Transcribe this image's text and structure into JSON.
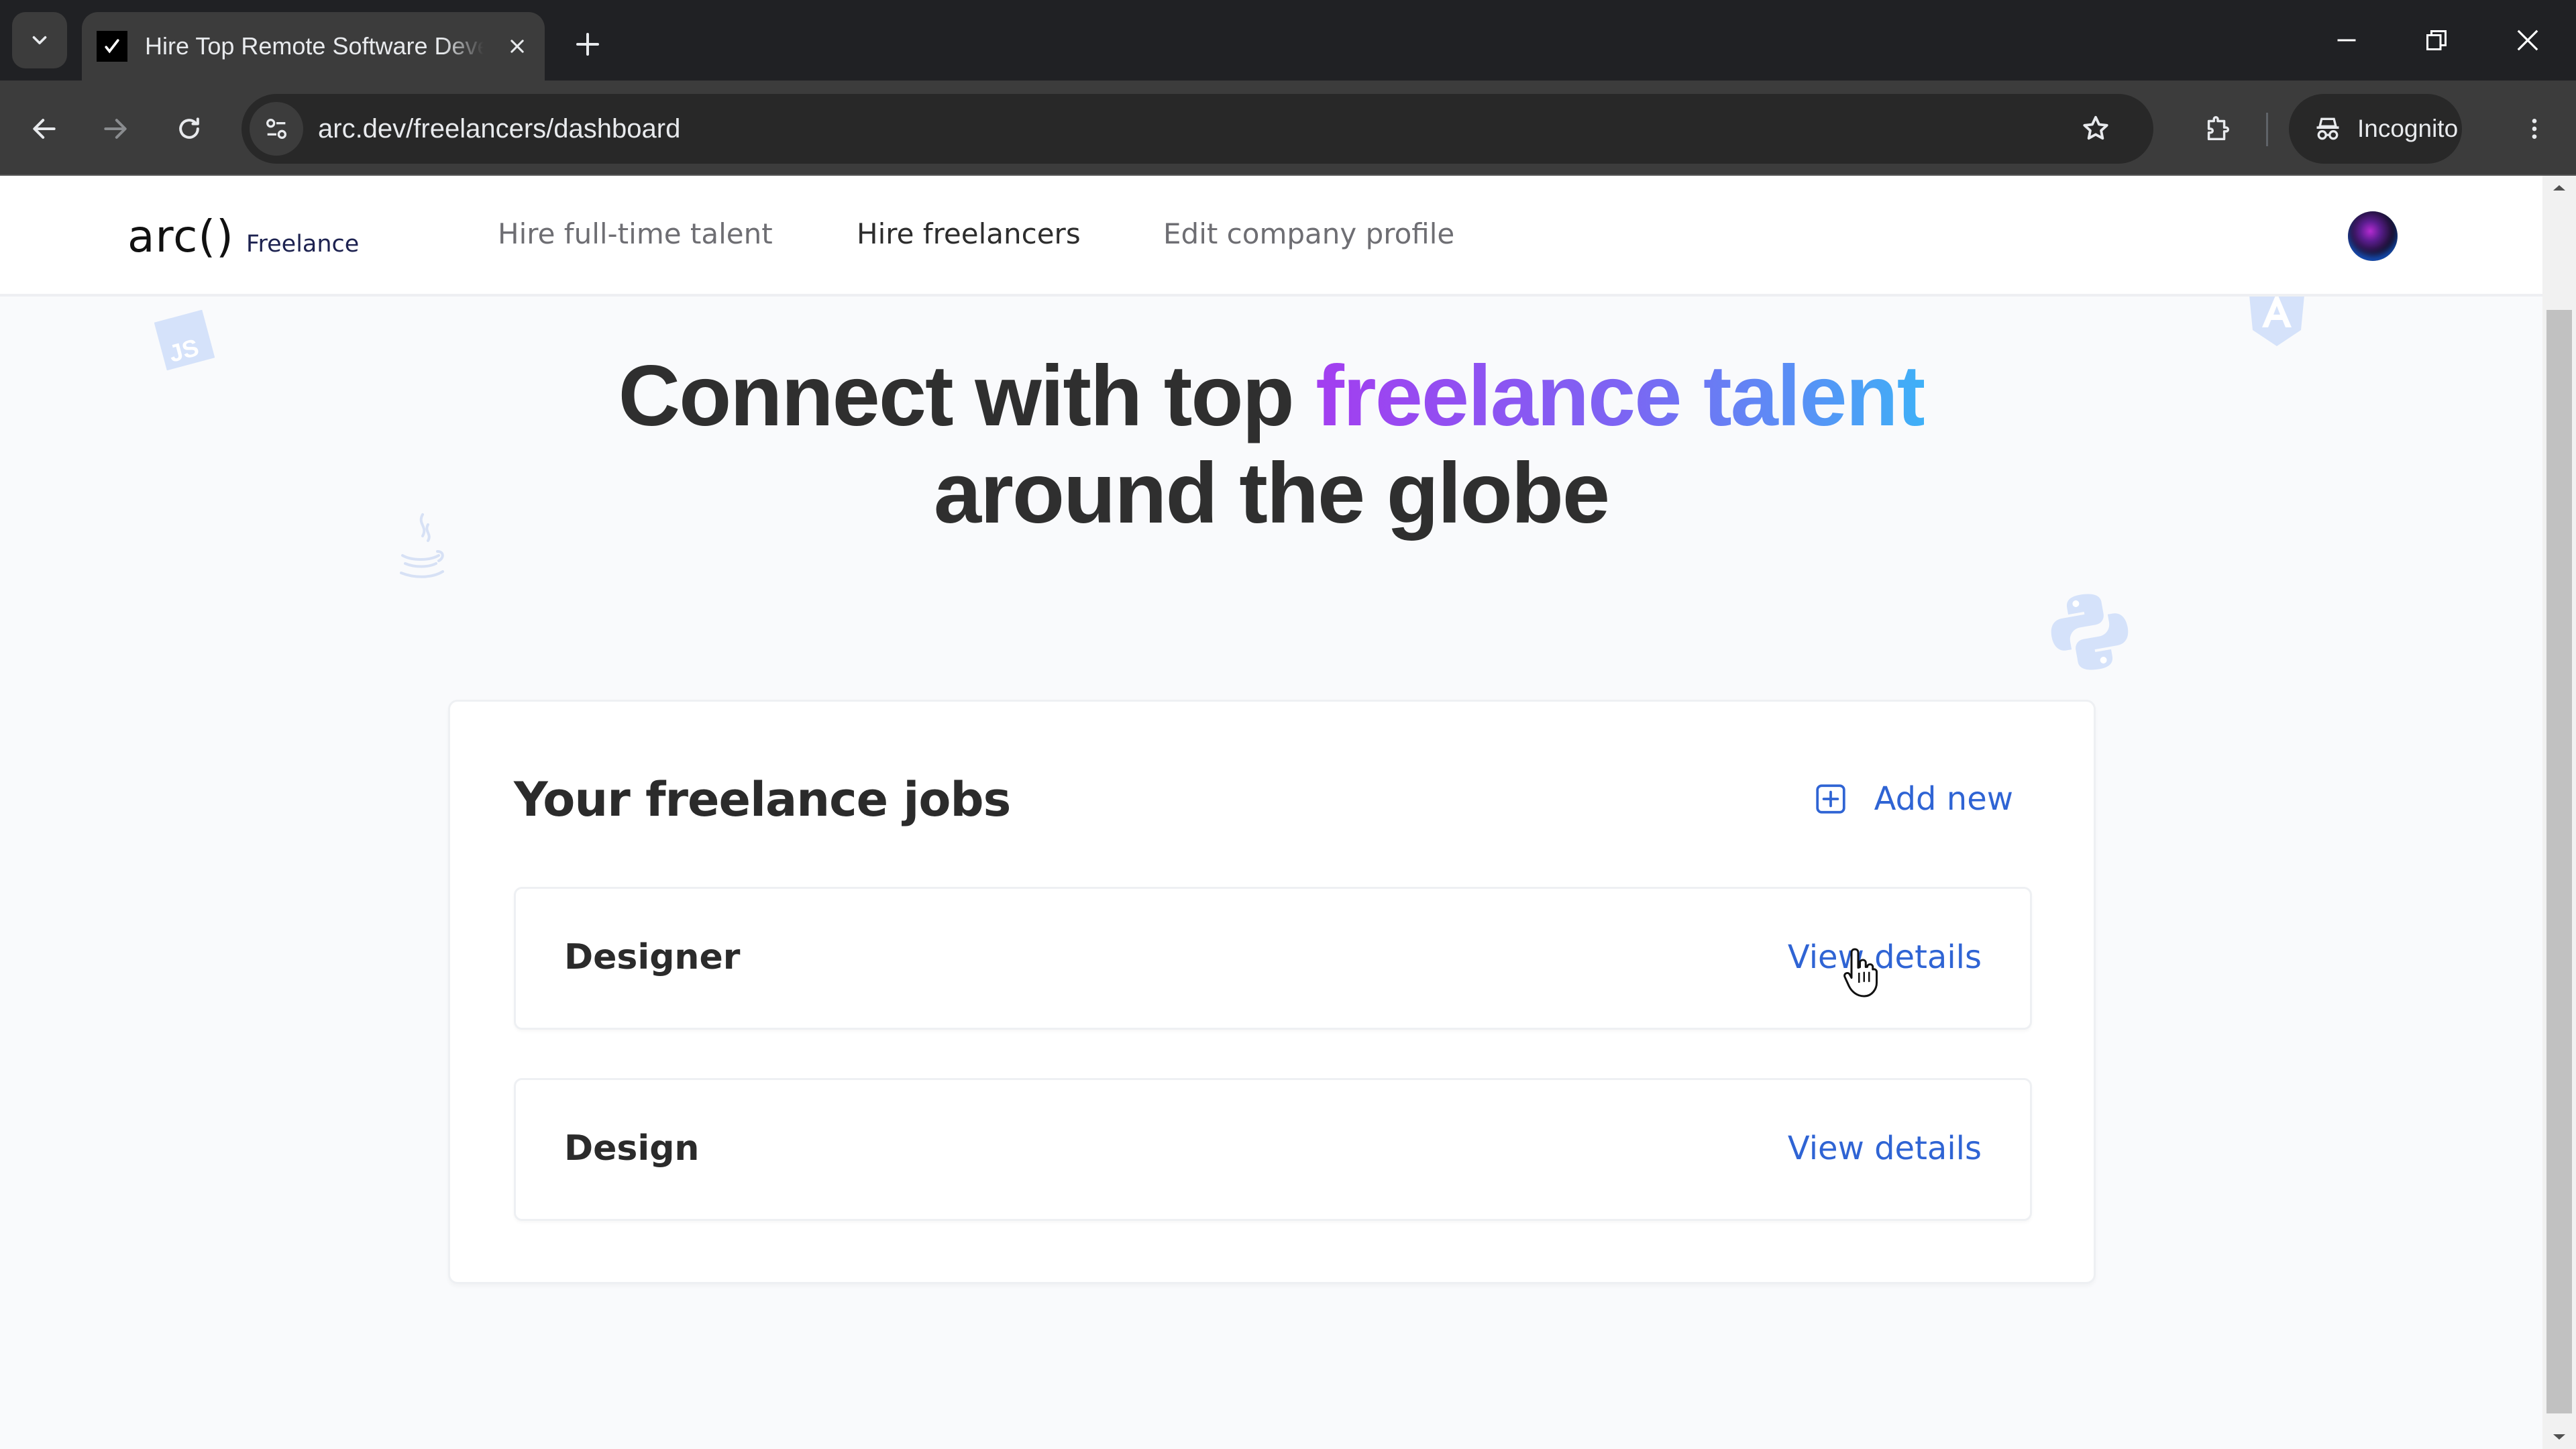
{
  "browser": {
    "tab": {
      "title": "Hire Top Remote Software Developers",
      "favicon": "arc-check-icon"
    },
    "url": "arc.dev/freelancers/dashboard",
    "profile_label": "Incognito",
    "icons": [
      "tab-search-icon",
      "close-icon",
      "plus-icon",
      "minimize-icon",
      "restore-icon",
      "window-close-icon",
      "back-icon",
      "forward-icon",
      "reload-icon",
      "site-info-icon",
      "star-icon",
      "extensions-icon",
      "incognito-icon",
      "more-vert-icon"
    ]
  },
  "site": {
    "logo": {
      "mark": "arc()",
      "sub": "Freelance"
    },
    "nav": [
      {
        "label": "Hire full-time talent",
        "active": false
      },
      {
        "label": "Hire freelancers",
        "active": true
      },
      {
        "label": "Edit company profile",
        "active": false
      }
    ],
    "decorative_icons": [
      "javascript-icon",
      "java-icon",
      "angular-icon",
      "python-icon"
    ]
  },
  "hero": {
    "line1_prefix": "Connect with top",
    "line1_highlight": "freelance talent",
    "line2": "around the globe",
    "gradient_colors": [
      "#a33ef0",
      "#7d64f3",
      "#3fb0f7"
    ]
  },
  "jobs": {
    "title": "Your freelance jobs",
    "add_new_label": "Add new",
    "items": [
      {
        "title": "Designer",
        "action_label": "View details"
      },
      {
        "title": "Design",
        "action_label": "View details"
      }
    ]
  },
  "colors": {
    "link": "#2f64d4",
    "heading": "#2b2b2b",
    "page_bg": "#f9fafc",
    "chrome_bg": "#202124"
  }
}
